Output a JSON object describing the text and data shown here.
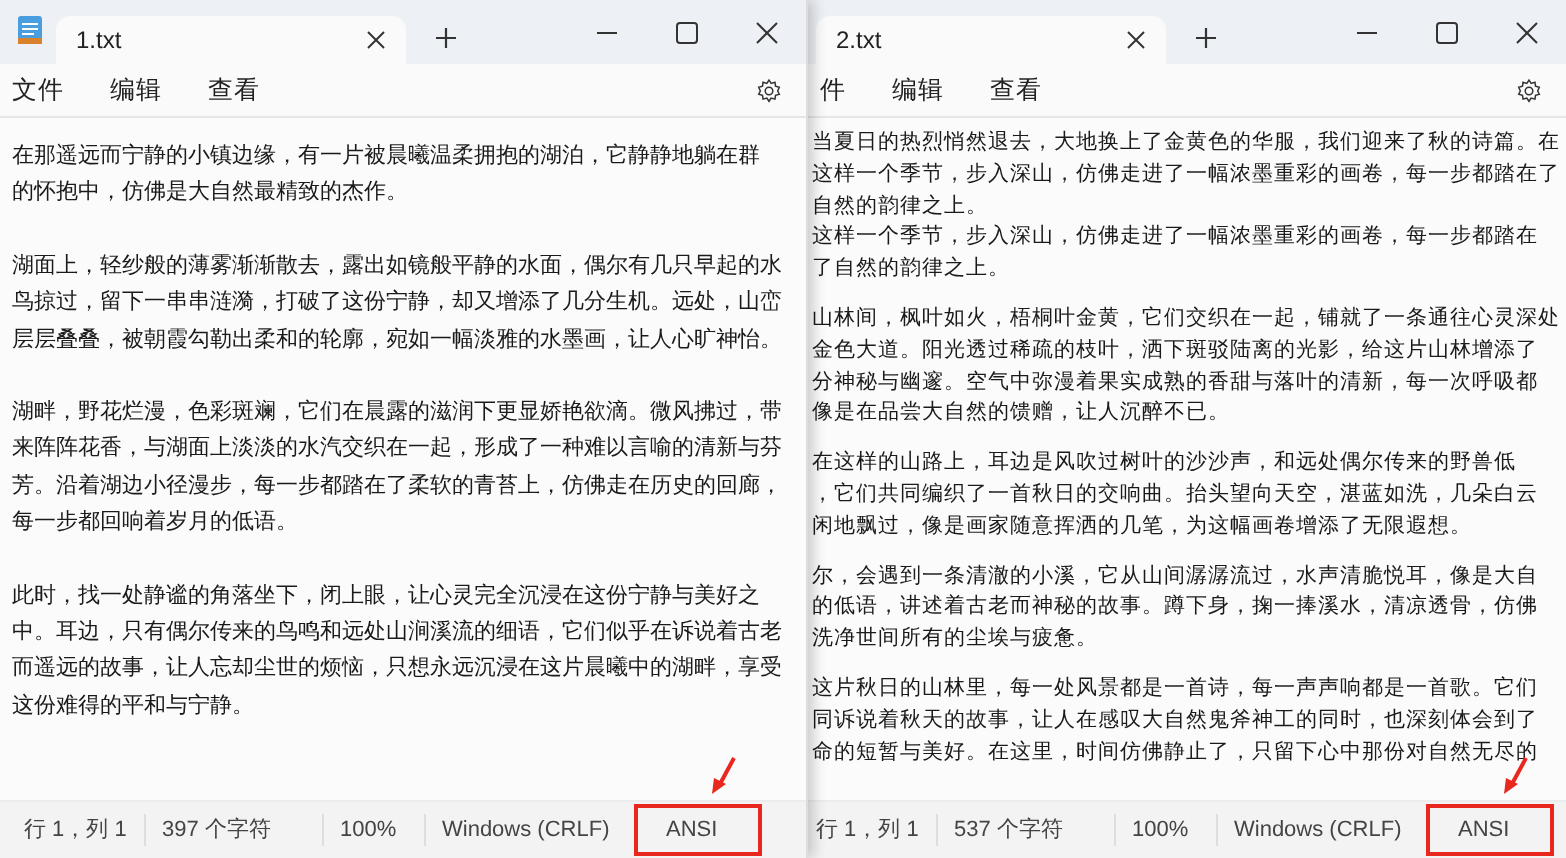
{
  "windows": [
    {
      "tab": {
        "title": "1.txt",
        "selected": true
      },
      "show_app_icon": true,
      "menu": [
        "文件",
        "编辑",
        "查看"
      ],
      "paragraphs": [
        [
          "在那遥远而宁静的小镇边缘，有一片被晨曦温柔拥抱的湖泊，它静静地躺在群",
          "的怀抱中，仿佛是大自然最精致的杰作。"
        ],
        [
          "湖面上，轻纱般的薄雾渐渐散去，露出如镜般平静的水面，偶尔有几只早起的水",
          "鸟掠过，留下一串串涟漪，打破了这份宁静，却又增添了几分生机。远处，山峦",
          "层层叠叠，被朝霞勾勒出柔和的轮廓，宛如一幅淡雅的水墨画，让人心旷神怡。"
        ],
        [
          "湖畔，野花烂漫，色彩斑斓，它们在晨露的滋润下更显娇艳欲滴。微风拂过，带",
          "来阵阵花香，与湖面上淡淡的水汽交织在一起，形成了一种难以言喻的清新与芬",
          "芳。沿着湖边小径漫步，每一步都踏在了柔软的青苔上，仿佛走在历史的回廊，",
          "每一步都回响着岁月的低语。"
        ],
        [
          "此时，找一处静谧的角落坐下，闭上眼，让心灵完全沉浸在这份宁静与美好之",
          "中。耳边，只有偶尔传来的鸟鸣和远处山涧溪流的细语，它们似乎在诉说着古老",
          "而遥远的故事，让人忘却尘世的烦恼，只想永远沉浸在这片晨曦中的湖畔，享受",
          "这份难得的平和与宁静。"
        ]
      ],
      "status": [
        {
          "text": "行 1，列 1",
          "highlighted": false
        },
        {
          "text": "397 个字符",
          "highlighted": false
        },
        {
          "text": "100%",
          "highlighted": false
        },
        {
          "text": "Windows (CRLF)",
          "highlighted": false
        },
        {
          "text": "ANSI",
          "highlighted": true
        }
      ]
    },
    {
      "tab": {
        "title": "2.txt",
        "selected": true
      },
      "show_app_icon": false,
      "menu": [
        "件",
        "编辑",
        "查看"
      ],
      "paragraphs": [
        [
          "当夏日的热烈悄然退去，大地换上了金黄色的华服，我们迎来了秋的诗篇。在",
          "这样一个季节，步入深山，仿佛走进了一幅浓墨重彩的画卷，每一步都踏在了",
          "自然的韵律之上。",
          "这样一个季节，步入深山，仿佛走进了一幅浓墨重彩的画卷，每一步都踏在",
          "了自然的韵律之上。"
        ],
        [
          "山林间，枫叶如火，梧桐叶金黄，它们交织在一起，铺就了一条通往心灵深处",
          "金色大道。阳光透过稀疏的枝叶，洒下斑驳陆离的光影，给这片山林增添了",
          "分神秘与幽邃。空气中弥漫着果实成熟的香甜与落叶的清新，每一次呼吸都",
          "像是在品尝大自然的馈赠，让人沉醉不已。"
        ],
        [
          "在这样的山路上，耳边是风吹过树叶的沙沙声，和远处偶尔传来的野兽低",
          "，它们共同编织了一首秋日的交响曲。抬头望向天空，湛蓝如洗，几朵白云",
          "闲地飘过，像是画家随意挥洒的几笔，为这幅画卷增添了无限遐想。"
        ],
        [
          "尔，会遇到一条清澈的小溪，它从山间潺潺流过，水声清脆悦耳，像是大自",
          "的低语，讲述着古老而神秘的故事。蹲下身，掬一捧溪水，清凉透骨，仿佛",
          "洗净世间所有的尘埃与疲惫。"
        ],
        [
          "这片秋日的山林里，每一处风景都是一首诗，每一声声响都是一首歌。它们",
          "同诉说着秋天的故事，让人在感叹大自然鬼斧神工的同时，也深刻体会到了",
          "命的短暂与美好。在这里，时间仿佛静止了，只留下心中那份对自然无尽的"
        ]
      ],
      "status": [
        {
          "text": "行 1，列 1",
          "highlighted": false
        },
        {
          "text": "537 个字符",
          "highlighted": false
        },
        {
          "text": "100%",
          "highlighted": false
        },
        {
          "text": "Windows (CRLF)",
          "highlighted": false
        },
        {
          "text": "ANSI",
          "highlighted": true
        }
      ]
    }
  ]
}
